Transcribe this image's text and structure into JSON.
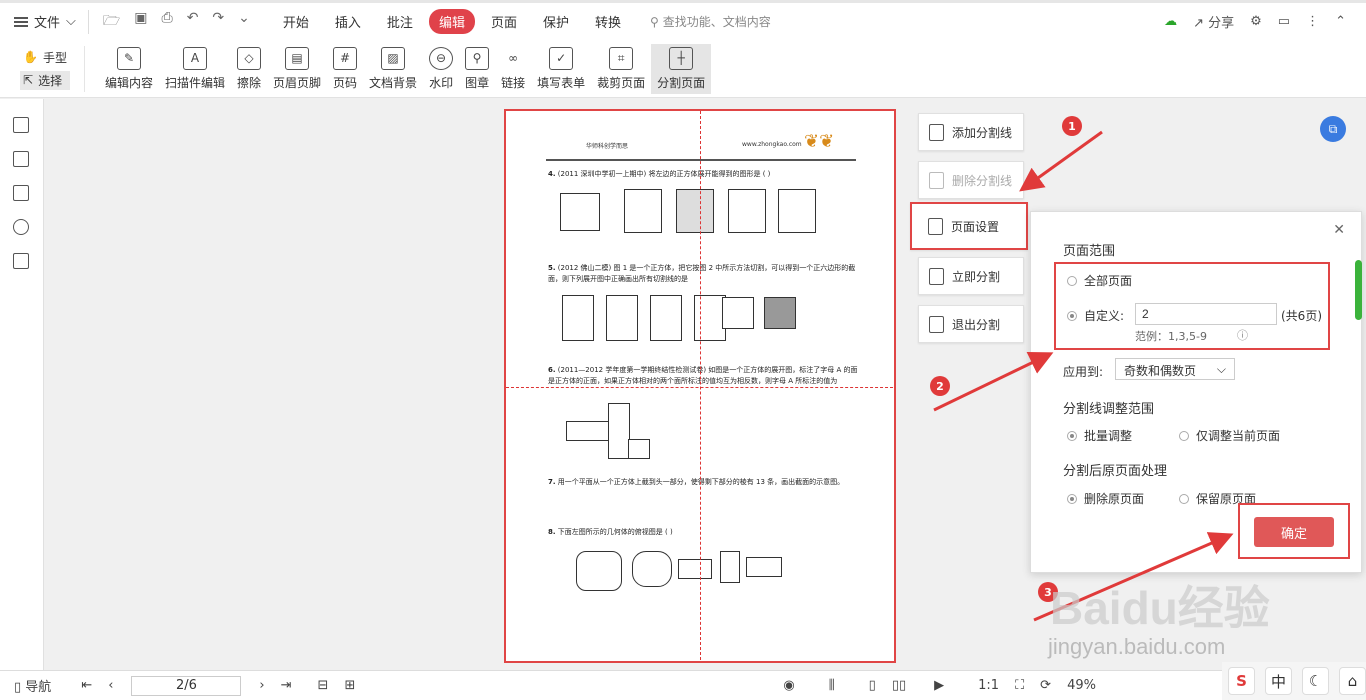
{
  "topbar": {
    "file_menu": "文件",
    "tabs": [
      "开始",
      "插入",
      "批注",
      "编辑",
      "页面",
      "保护",
      "转换"
    ],
    "active_tab": "编辑",
    "search_placeholder": "查找功能、文档内容",
    "share_label": "分享"
  },
  "ribbon": {
    "hand_tool": "手型",
    "select_tool": "选择",
    "tools": [
      "编辑内容",
      "扫描件编辑",
      "擦除",
      "页眉页脚",
      "页码",
      "文档背景",
      "水印",
      "图章",
      "链接",
      "填写表单",
      "裁剪页面",
      "分割页面"
    ],
    "tool_icons": [
      "edit-content-icon",
      "scan-edit-icon",
      "eraser-icon",
      "header-footer-icon",
      "page-number-icon",
      "background-icon",
      "watermark-icon",
      "stamp-icon",
      "link-icon",
      "form-icon",
      "crop-icon",
      "split-page-icon"
    ]
  },
  "document": {
    "header_left": "华师科创学而思",
    "header_right": "www.zhongkao.com",
    "q4": "(2011 深圳中学初一上期中) 将左边的正方体展开能得到的图形是 ( )",
    "q5": "(2012 佛山二模) 图 1 是一个正方体，把它按图 2 中所示方法切割，可以得到一个正六边形的截面，则下列展开图中正确画出所有切割线的是",
    "q6": "(2011—2012 学年度第一学期终结性检测试卷) 如图是一个正方体的展开图，标注了字母 A 的面是正方体的正面，如果正方体相对的两个面所标注的值均互为相反数，则字母 A 所标注的值为",
    "q7": "用一个平面从一个正方体上截到头一部分，使得剩下部分的棱有 13 条，画出截面的示意图。",
    "q8": "下面左图所示的几何体的俯视图是 ( )",
    "q4_num": "4.",
    "q5_num": "5.",
    "q6_num": "6.",
    "q7_num": "7.",
    "q8_num": "8."
  },
  "split_actions": {
    "add_line": "添加分割线",
    "delete_line": "删除分割线",
    "page_setup": "页面设置",
    "split_now": "立即分割",
    "exit_split": "退出分割"
  },
  "panel": {
    "range_title": "页面范围",
    "all_pages": "全部页面",
    "custom": "自定义:",
    "custom_value": "2",
    "total_pages": "(共6页)",
    "example": "范例：1,3,5-9",
    "apply_to_label": "应用到:",
    "apply_to_value": "奇数和偶数页",
    "line_adjust_title": "分割线调整范围",
    "batch_adjust": "批量调整",
    "current_only": "仅调整当前页面",
    "after_split_title": "分割后原页面处理",
    "delete_original": "删除原页面",
    "keep_original": "保留原页面",
    "confirm": "确定"
  },
  "annotations": {
    "badge1": "1",
    "badge2": "2",
    "badge3": "3"
  },
  "statusbar": {
    "nav": "导航",
    "page_indicator": "2/6",
    "zoom": "49%",
    "ratio": "1:1"
  },
  "watermark": {
    "brand": "Baidu经验",
    "url": "jingyan.baidu.com"
  },
  "ime": {
    "lang": "中"
  }
}
